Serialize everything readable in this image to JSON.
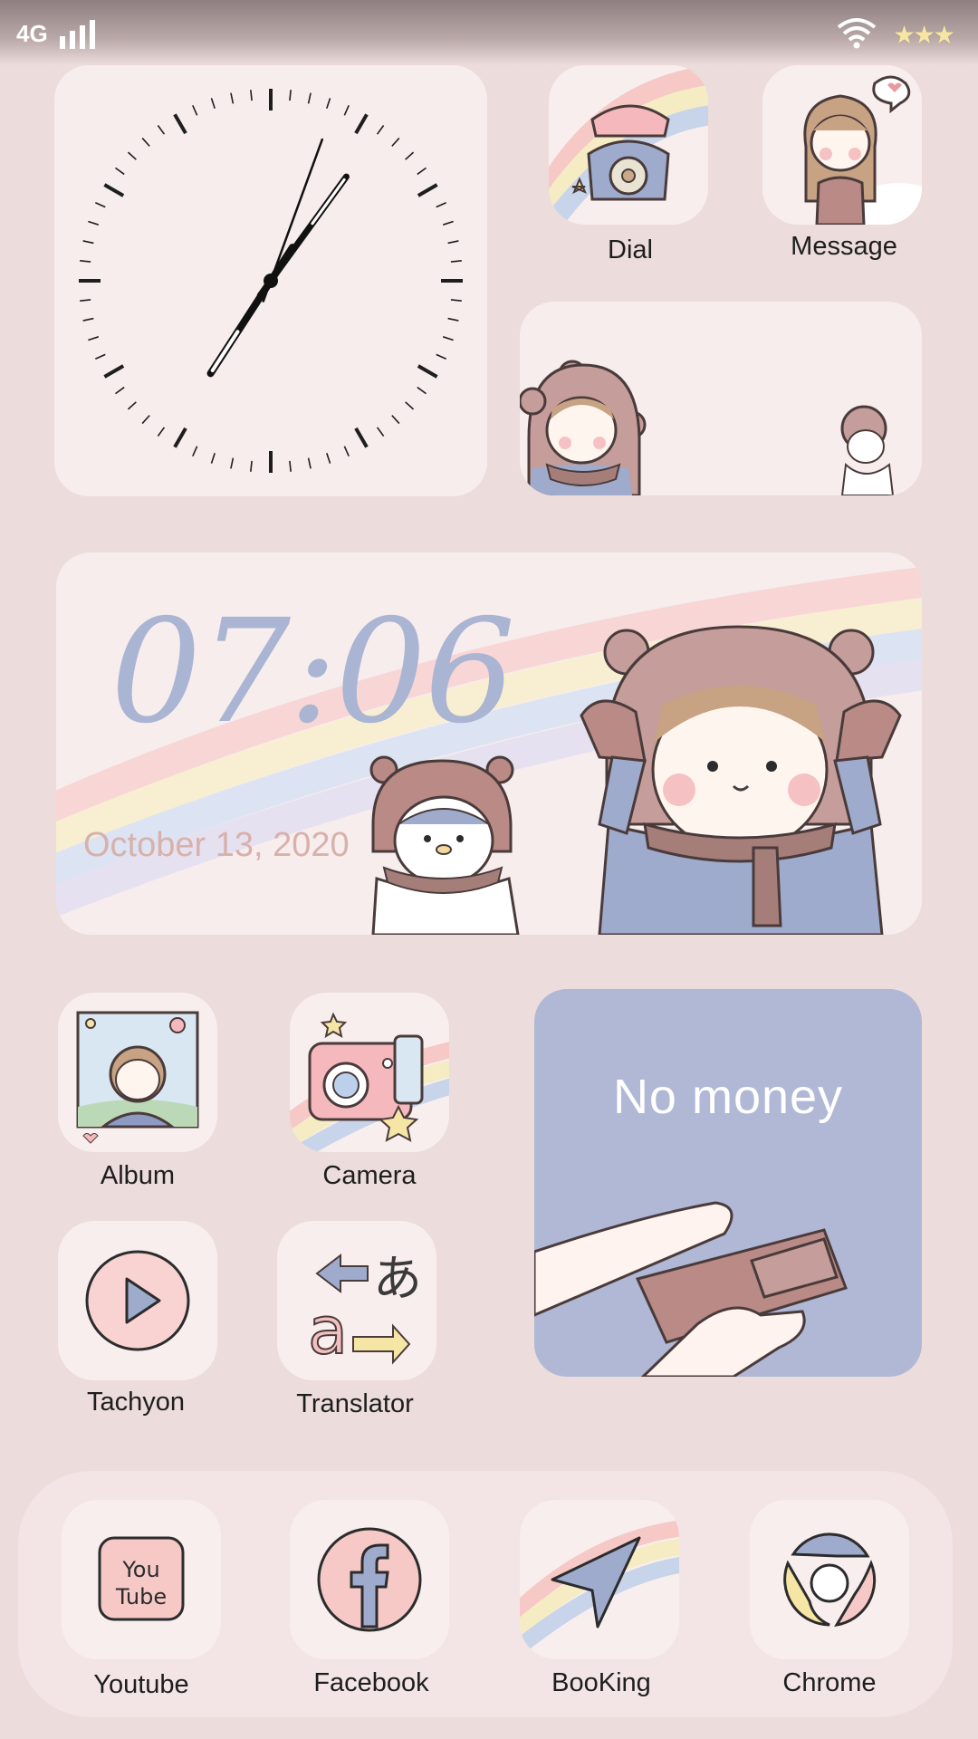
{
  "status_bar": {
    "network": "4G",
    "signal_icon": "signal-bars-icon",
    "wifi_icon": "wifi-icon",
    "stars": "★★★"
  },
  "clock_widget": {
    "type": "analog-clock",
    "hour": 7,
    "minute": 6
  },
  "time_widget": {
    "time": "07:06",
    "date": "October 13, 2020"
  },
  "money_widget": {
    "text": "No money"
  },
  "apps": {
    "dial": "Dial",
    "message": "Message",
    "album": "Album",
    "camera": "Camera",
    "tachyon": "Tachyon",
    "translator": "Translator"
  },
  "dock": {
    "youtube": "Youtube",
    "youtube_icon_text_1": "You",
    "youtube_icon_text_2": "Tube",
    "facebook": "Facebook",
    "booking": "BooKing",
    "chrome": "Chrome"
  },
  "colors": {
    "background": "#ecdcdb",
    "accent_blue": "#aab4d3",
    "pink": "#f6cccc",
    "brown": "#b98a86"
  }
}
